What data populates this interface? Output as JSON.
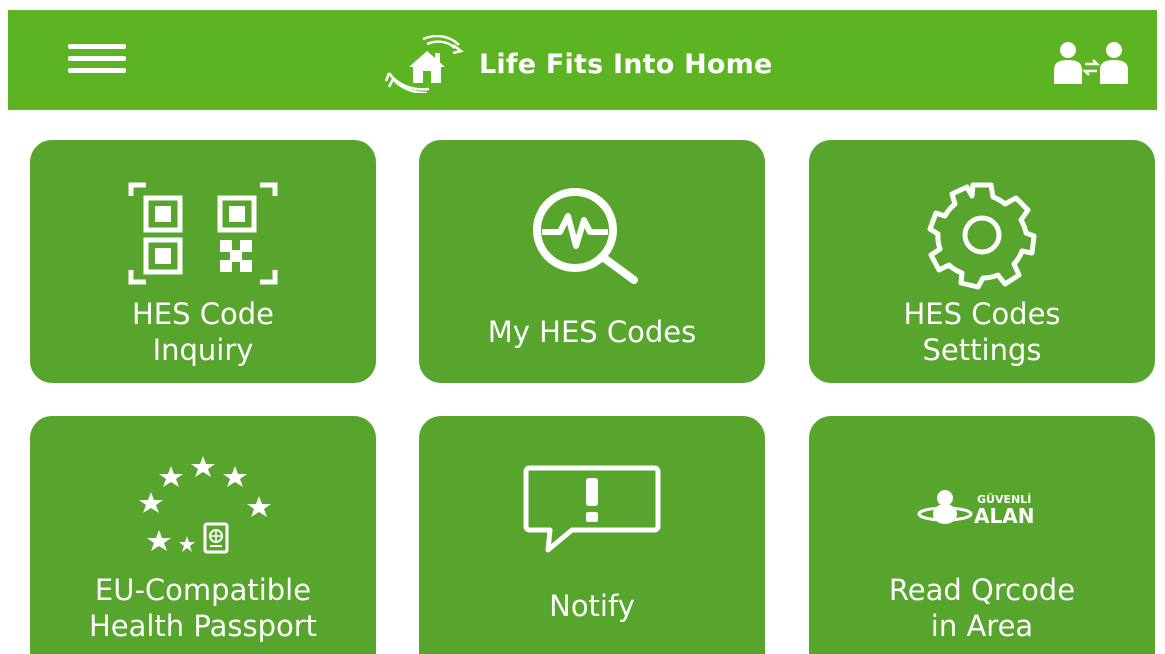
{
  "header": {
    "title": "Life Fits Into Home",
    "menu_icon": "hamburger-menu-icon",
    "logo_icon": "house-in-hands-icon",
    "switch_icon": "switch-user-icon",
    "bar_color": "#5db423"
  },
  "tiles": [
    {
      "label_line1": "HES Code",
      "label_line2": "Inquiry",
      "icon": "qr-code-scan-icon"
    },
    {
      "label_line1": "My HES Codes",
      "icon": "magnifier-heartbeat-icon"
    },
    {
      "label_line1": "HES Codes",
      "label_line2": "Settings",
      "icon": "gear-icon"
    },
    {
      "label_line1": "EU-Compatible",
      "label_line2": "Health Passport",
      "icon": "eu-stars-passport-icon"
    },
    {
      "label_line1": "Notify",
      "icon": "exclamation-speech-bubble-icon"
    },
    {
      "label_line1": "Read Qrcode",
      "label_line2": "in Area",
      "icon": "guvenli-alan-icon",
      "icon_text_top": "GÜVENLİ",
      "icon_text_bottom": "ALAN"
    }
  ],
  "tile_color": "#57a52c"
}
